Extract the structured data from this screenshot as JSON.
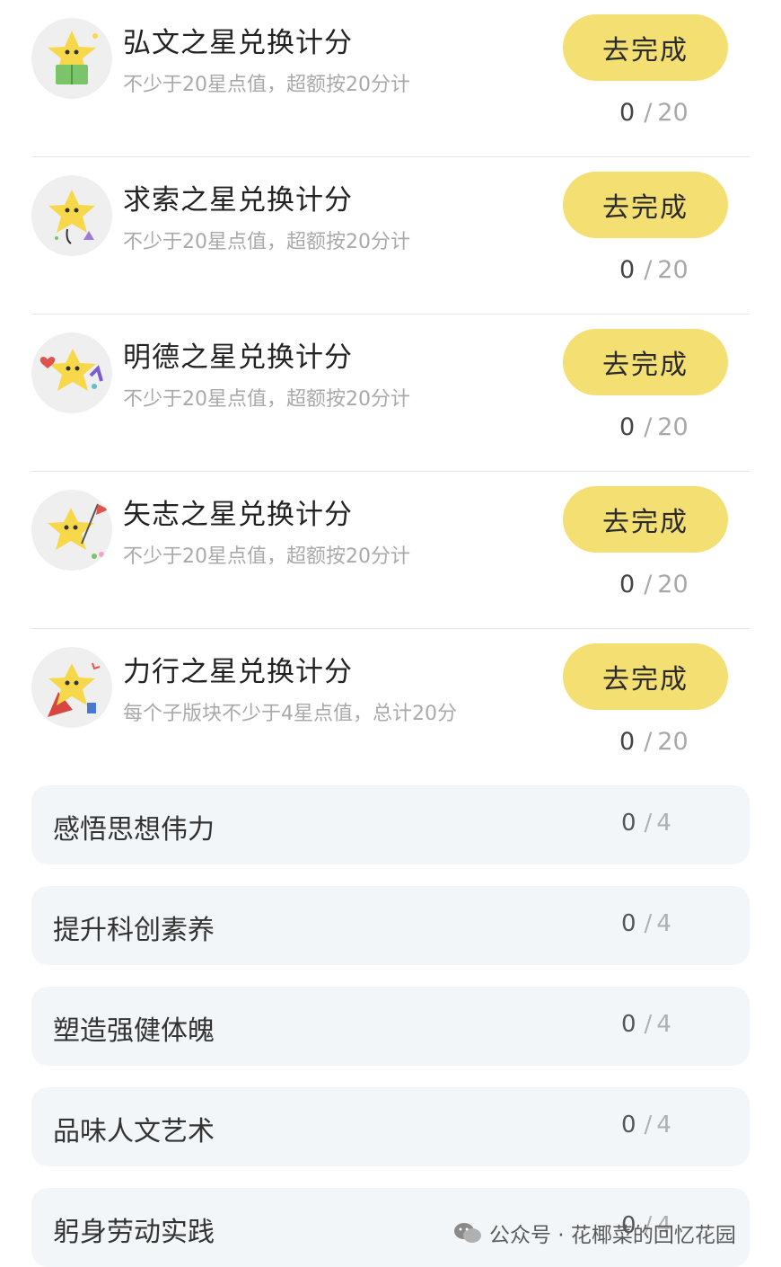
{
  "tasks": [
    {
      "title": "弘文之星兑换计分",
      "desc": "不少于20星点值，超额按20分计",
      "button": "去完成",
      "current": "0",
      "sep": "/",
      "total": "20",
      "icon": "star-reading-book-icon"
    },
    {
      "title": "求索之星兑换计分",
      "desc": "不少于20星点值，超额按20分计",
      "button": "去完成",
      "current": "0",
      "sep": "/",
      "total": "20",
      "icon": "star-exploring-icon"
    },
    {
      "title": "明德之星兑换计分",
      "desc": "不少于20星点值，超额按20分计",
      "button": "去完成",
      "current": "0",
      "sep": "/",
      "total": "20",
      "icon": "star-heart-icon"
    },
    {
      "title": "矢志之星兑换计分",
      "desc": "不少于20星点值，超额按20分计",
      "button": "去完成",
      "current": "0",
      "sep": "/",
      "total": "20",
      "icon": "star-flag-icon"
    },
    {
      "title": "力行之星兑换计分",
      "desc": "每个子版块不少于4星点值，总计20分",
      "button": "去完成",
      "current": "0",
      "sep": "/",
      "total": "20",
      "icon": "star-hero-icon"
    }
  ],
  "subtasks": [
    {
      "label": "感悟思想伟力",
      "current": "0",
      "sep": "/",
      "total": "4"
    },
    {
      "label": "提升科创素养",
      "current": "0",
      "sep": "/",
      "total": "4"
    },
    {
      "label": "塑造强健体魄",
      "current": "0",
      "sep": "/",
      "total": "4"
    },
    {
      "label": "品味人文艺术",
      "current": "0",
      "sep": "/",
      "total": "4"
    },
    {
      "label": "躬身劳动实践",
      "current": "0",
      "sep": "/",
      "total": "4"
    }
  ],
  "watermark": {
    "text": "公众号 · 花椰菜的回忆花园",
    "icon": "wechat-icon"
  },
  "colors": {
    "accent": "#f4df72",
    "star": "#f7d84a",
    "subBg": "#f3f6f8"
  }
}
